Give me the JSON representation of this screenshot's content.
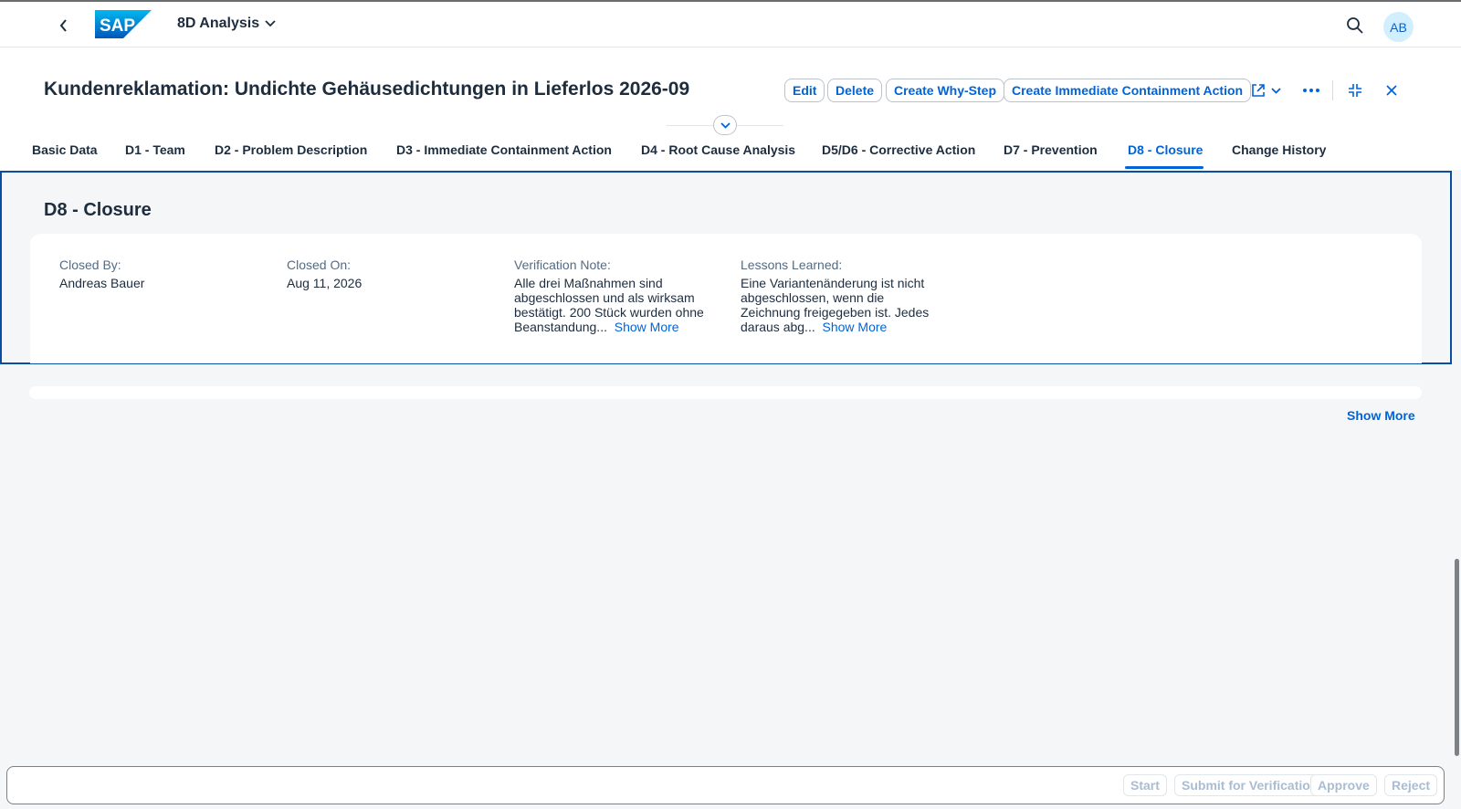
{
  "shell": {
    "app_title": "8D Analysis",
    "logo_text": "SAP",
    "avatar_initials": "AB"
  },
  "header": {
    "title": "Kundenreklamation: Undichte Gehäusedichtungen in Lieferlos 2026-09",
    "actions": {
      "edit": "Edit",
      "delete": "Delete",
      "create_why_step": "Create Why-Step",
      "create_containment": "Create Immediate Containment Action"
    }
  },
  "tabs": [
    {
      "label": "Basic Data"
    },
    {
      "label": "D1 - Team"
    },
    {
      "label": "D2 - Problem Description"
    },
    {
      "label": "D3 - Immediate Containment Action"
    },
    {
      "label": "D4 - Root Cause Analysis"
    },
    {
      "label": "D5/D6 - Corrective Action"
    },
    {
      "label": "D7 - Prevention"
    },
    {
      "label": "D8 - Closure"
    },
    {
      "label": "Change History"
    }
  ],
  "active_tab": "D8 - Closure",
  "section": {
    "title": "D8 - Closure",
    "fields": [
      {
        "label": "Closed By:",
        "value": "Andreas Bauer"
      },
      {
        "label": "Closed On:",
        "value": "Aug 11, 2026"
      },
      {
        "label": "Verification Note:",
        "value": "Alle drei Maßnahmen sind abgeschlossen und als wirksam bestätigt. 200 Stück wurden ohne Beanstandung...",
        "more": "Show More"
      },
      {
        "label": "Lessons Learned:",
        "value": "Eine Variantenänderung ist nicht abgeschlossen, wenn die Zeichnung freigegeben ist. Jedes daraus abg...",
        "more": "Show More"
      }
    ]
  },
  "show_more_label": "Show More",
  "footer": {
    "start": "Start",
    "submit": "Submit for Verification",
    "approve": "Approve",
    "reject": "Reject"
  },
  "colors": {
    "accent": "#0064d9",
    "section_border": "#0a4ea3",
    "disabled_text": "#a9bcd1"
  }
}
